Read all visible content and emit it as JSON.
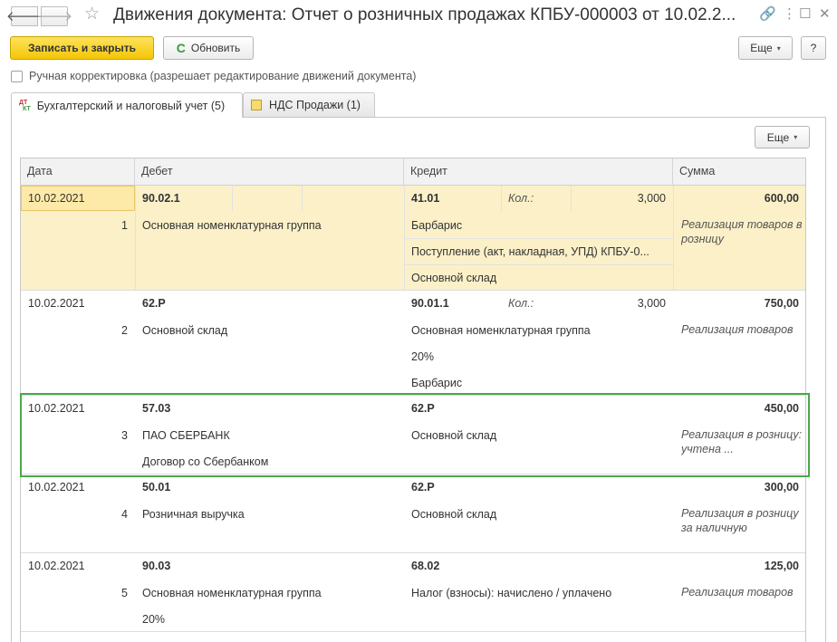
{
  "window": {
    "title": "Движения документа: Отчет о розничных продажах КПБУ-000003 от 10.02.2...",
    "nav_back": "🡐",
    "nav_forward": "🡒",
    "favorite_glyph": "☆",
    "link_glyph": "🔗",
    "more_glyph": "⋮",
    "maximize_glyph": "☐",
    "close_glyph": "✕"
  },
  "toolbar": {
    "save_close_label": "Записать и закрыть",
    "refresh_label": "Обновить",
    "refresh_glyph": "C",
    "more_label": "Еще",
    "more_caret": "▾",
    "help_label": "?"
  },
  "manual_correction": {
    "label": "Ручная корректировка (разрешает редактирование движений документа)"
  },
  "tabs": [
    {
      "label": "Бухгалтерский и налоговый учет (5)",
      "icon": "dt-kt-icon",
      "icon_dt": "ДТ",
      "icon_kt": "КТ"
    },
    {
      "label": "НДС Продажи (1)",
      "icon": "nds-icon"
    }
  ],
  "panel": {
    "more_label": "Еще",
    "more_caret": "▾"
  },
  "table": {
    "headers": {
      "date": "Дата",
      "debit": "Дебет",
      "credit": "Кредит",
      "sum": "Сумма"
    },
    "rows": [
      {
        "date": "10.02.2021",
        "num": "1",
        "debit_account": "90.02.1",
        "debit_sub": [
          "Основная номенклатурная группа"
        ],
        "credit_account": "41.01",
        "qty_label": "Кол.:",
        "qty": "3,000",
        "credit_sub": [
          "Барбарис",
          "Поступление (акт, накладная, УПД) КПБУ-0...",
          "Основной склад"
        ],
        "sum": "600,00",
        "description": "Реализация товаров в розницу"
      },
      {
        "date": "10.02.2021",
        "num": "2",
        "debit_account": "62.Р",
        "debit_sub": [
          "Основной склад"
        ],
        "credit_account": "90.01.1",
        "qty_label": "Кол.:",
        "qty": "3,000",
        "credit_sub": [
          "Основная номенклатурная группа",
          "20%",
          "Барбарис"
        ],
        "sum": "750,00",
        "description": "Реализация товаров"
      },
      {
        "date": "10.02.2021",
        "num": "3",
        "debit_account": "57.03",
        "debit_sub": [
          "ПАО СБЕРБАНК",
          "Договор со Сбербанком"
        ],
        "credit_account": "62.Р",
        "credit_sub": [
          "Основной склад"
        ],
        "sum": "450,00",
        "description": "Реализация в розницу: учтена ..."
      },
      {
        "date": "10.02.2021",
        "num": "4",
        "debit_account": "50.01",
        "debit_sub": [
          "Розничная выручка"
        ],
        "credit_account": "62.Р",
        "credit_sub": [
          "Основной склад"
        ],
        "sum": "300,00",
        "description": "Реализация в розницу за наличную"
      },
      {
        "date": "10.02.2021",
        "num": "5",
        "debit_account": "90.03",
        "debit_sub": [
          "Основная номенклатурная группа",
          "20%"
        ],
        "credit_account": "68.02",
        "credit_sub": [
          "Налог (взносы): начислено / уплачено"
        ],
        "sum": "125,00",
        "description": "Реализация товаров"
      }
    ]
  },
  "colors": {
    "primary_button": "#f4c608",
    "selected_row": "#fbf0c8",
    "highlight_border": "#4aa84a"
  }
}
